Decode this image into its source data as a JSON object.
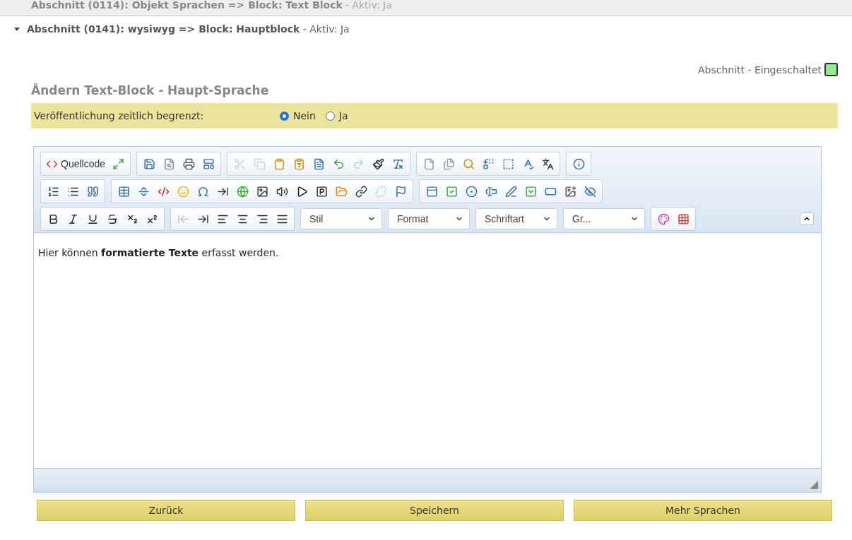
{
  "previous_section": {
    "title": "Abschnitt (0114): Objekt Sprachen => Block: Text Block",
    "status": "- Aktiv: Ja"
  },
  "section": {
    "title": "Abschnitt (0141): wysiwyg => Block: Hauptblock",
    "status": "- Aktiv: Ja",
    "expanded": true
  },
  "section_switch": {
    "label": "Abschnitt - Eingeschaltet",
    "on": true
  },
  "form_title": "Ändern Text-Block - Haupt-Sprache",
  "publication": {
    "label": "Veröffentlichung zeitlich begrenzt:",
    "options": [
      {
        "label": "Nein",
        "selected": true
      },
      {
        "label": "Ja",
        "selected": false
      }
    ]
  },
  "editor": {
    "toolbar_rows": [
      [
        [
          {
            "kind": "labeled",
            "label": "Quellcode",
            "disabled": false
          },
          {
            "kind": "icon",
            "disabled": false
          }
        ],
        [
          {
            "kind": "icon",
            "disabled": false
          },
          {
            "kind": "icon",
            "disabled": false
          },
          {
            "kind": "icon",
            "disabled": false
          },
          {
            "kind": "icon",
            "disabled": false
          }
        ],
        [
          {
            "kind": "icon",
            "disabled": true
          },
          {
            "kind": "icon",
            "disabled": true
          },
          {
            "kind": "icon",
            "disabled": false
          },
          {
            "kind": "icon",
            "disabled": false
          },
          {
            "kind": "icon",
            "disabled": false
          },
          {
            "kind": "icon",
            "disabled": false
          },
          {
            "kind": "icon",
            "disabled": true
          },
          {
            "kind": "icon",
            "disabled": false
          },
          {
            "kind": "icon",
            "disabled": false
          }
        ],
        [
          {
            "kind": "icon",
            "disabled": false
          },
          {
            "kind": "icon",
            "disabled": false
          },
          {
            "kind": "icon",
            "disabled": false
          },
          {
            "kind": "icon",
            "disabled": false
          },
          {
            "kind": "icon",
            "disabled": false
          },
          {
            "kind": "icon",
            "disabled": false
          },
          {
            "kind": "icon",
            "disabled": false
          }
        ],
        [
          {
            "kind": "icon",
            "disabled": false
          }
        ]
      ],
      [
        [
          {
            "kind": "icon",
            "disabled": false
          },
          {
            "kind": "icon",
            "disabled": false
          },
          {
            "kind": "icon",
            "disabled": false
          }
        ],
        [
          {
            "kind": "icon",
            "disabled": false
          },
          {
            "kind": "icon",
            "disabled": false
          },
          {
            "kind": "icon",
            "disabled": false
          },
          {
            "kind": "icon",
            "disabled": false
          },
          {
            "kind": "icon",
            "disabled": false
          },
          {
            "kind": "icon",
            "disabled": false
          },
          {
            "kind": "icon",
            "disabled": false
          },
          {
            "kind": "icon",
            "disabled": false
          },
          {
            "kind": "icon",
            "disabled": false
          },
          {
            "kind": "icon",
            "disabled": false
          },
          {
            "kind": "icon",
            "disabled": false
          },
          {
            "kind": "icon",
            "disabled": false
          },
          {
            "kind": "icon",
            "disabled": false
          },
          {
            "kind": "icon",
            "disabled": true
          },
          {
            "kind": "icon",
            "disabled": false
          }
        ],
        [
          {
            "kind": "icon",
            "disabled": false
          },
          {
            "kind": "icon",
            "disabled": false
          },
          {
            "kind": "icon",
            "disabled": false
          },
          {
            "kind": "icon",
            "disabled": false
          },
          {
            "kind": "icon",
            "disabled": false
          },
          {
            "kind": "icon",
            "disabled": false
          },
          {
            "kind": "icon",
            "disabled": false
          },
          {
            "kind": "icon",
            "disabled": false
          },
          {
            "kind": "icon",
            "disabled": false
          }
        ]
      ],
      [
        [
          {
            "kind": "icon",
            "disabled": false
          },
          {
            "kind": "icon",
            "disabled": false
          },
          {
            "kind": "icon",
            "disabled": false
          },
          {
            "kind": "icon",
            "disabled": false
          },
          {
            "kind": "icon",
            "disabled": false
          },
          {
            "kind": "icon",
            "disabled": false
          }
        ],
        [
          {
            "kind": "icon",
            "disabled": true
          },
          {
            "kind": "icon",
            "disabled": false
          },
          {
            "kind": "icon",
            "disabled": false
          },
          {
            "kind": "icon",
            "disabled": false
          },
          {
            "kind": "icon",
            "disabled": false
          },
          {
            "kind": "icon",
            "disabled": false
          }
        ],
        [
          {
            "kind": "combo",
            "label": "Stil",
            "disabled": false
          },
          {
            "kind": "combo",
            "label": "Format",
            "disabled": false
          },
          {
            "kind": "combo",
            "label": "Schriftart",
            "disabled": false
          },
          {
            "kind": "combo",
            "label": "Gr...",
            "disabled": false
          }
        ],
        [
          {
            "kind": "icon",
            "disabled": false
          },
          {
            "kind": "icon",
            "disabled": false
          }
        ]
      ]
    ],
    "content": "Hier können **formatierte Texte** erfasst werden."
  },
  "buttons": [
    "Zurück",
    "Speichern",
    "Mehr Sprachen"
  ]
}
